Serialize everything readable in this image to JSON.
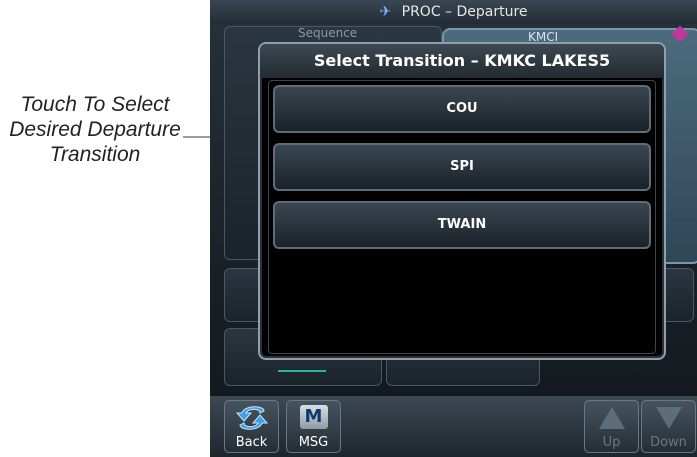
{
  "annotation": {
    "line1": "Touch To Select",
    "line2": "Desired Departure",
    "line3": "Transition"
  },
  "title_bar": {
    "title": "PROC – Departure",
    "icon": "plane-icon"
  },
  "background": {
    "sequence_label": "Sequence",
    "map_label": "KMCI",
    "accent_color": "#c0389a"
  },
  "popup": {
    "title": "Select Transition – KMKC LAKES5",
    "options": [
      "COU",
      "SPI",
      "TWAIN"
    ]
  },
  "bottom_bar": {
    "back_label": "Back",
    "msg_label": "MSG",
    "msg_icon_letter": "M",
    "up_label": "Up",
    "down_label": "Down"
  }
}
